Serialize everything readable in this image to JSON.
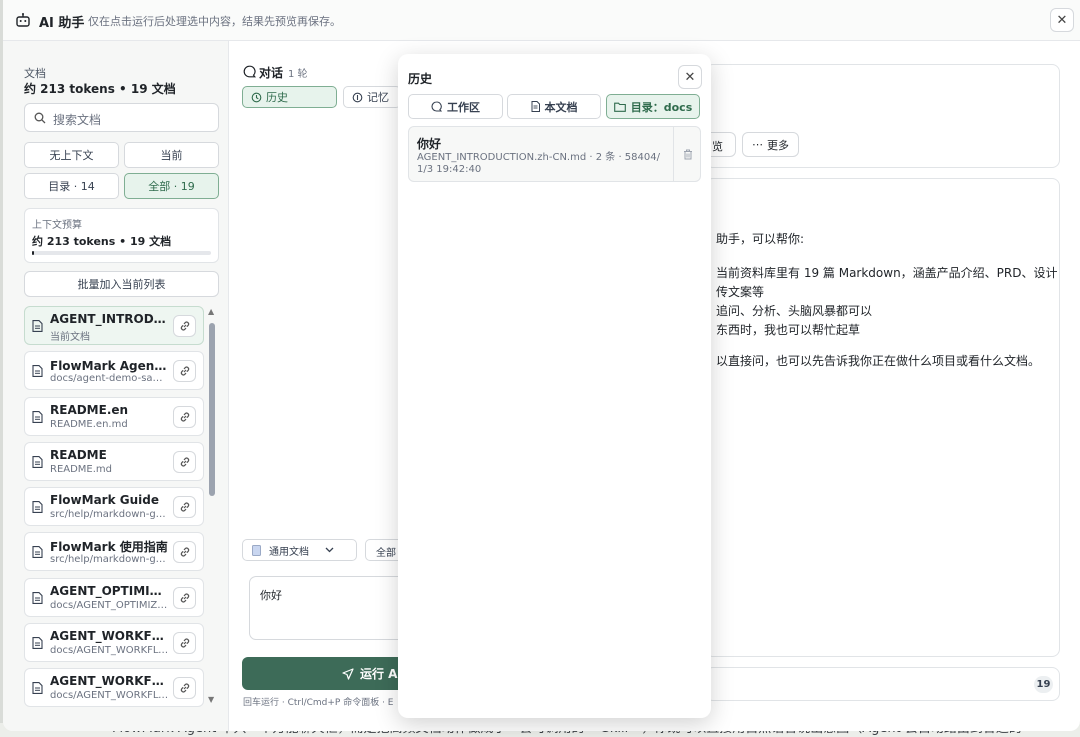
{
  "header": {
    "title": "AI 助手",
    "subtitle": "仅在点击运行后处理选中内容，结果先预览再保存。"
  },
  "sidebar": {
    "label": "文档",
    "tokens": "约 213 tokens • 19 文档",
    "search_placeholder": "搜索文档",
    "filters": [
      "无上下文",
      "当前",
      "目录 · 14",
      "全部 · 19"
    ],
    "active_filter": "全部 · 19",
    "budget_label": "上下文预算",
    "budget_value": "约 213 tokens • 19 文档",
    "budget_fraction": 0.01,
    "batch_label": "批量加入当前列表",
    "docs": [
      {
        "name": "AGENT_INTRODUCTION.zh-CN",
        "path": "当前文档"
      },
      {
        "name": "FlowMark Agent 演示",
        "path": "docs/agent-demo-samples"
      },
      {
        "name": "README.en",
        "path": "README.en.md"
      },
      {
        "name": "README",
        "path": "README.md"
      },
      {
        "name": "FlowMark Guide",
        "path": "src/help/markdown-guide"
      },
      {
        "name": "FlowMark 使用指南",
        "path": "src/help/markdown-guide"
      },
      {
        "name": "AGENT_OPTIMIZATION",
        "path": "docs/AGENT_OPTIMIZATION"
      },
      {
        "name": "AGENT_WORKFLOW",
        "path": "docs/AGENT_WORKFLOW"
      },
      {
        "name": "AGENT_WORKFLOW",
        "path": "docs/AGENT_WORKFLOW"
      }
    ]
  },
  "conversation": {
    "title": "对话",
    "rounds": "1 轮",
    "tabs": [
      "历史",
      "记忆"
    ],
    "template_select": "通用文档",
    "scope": "全部",
    "input_value": "你好",
    "run_label": "运行 AI",
    "hint": "回车运行 · Ctrl/Cmd+P 命令面板 · E"
  },
  "history": {
    "title": "历史",
    "filters": [
      "工作区",
      "本文档",
      "目录：docs"
    ],
    "active_filter": "目录：docs",
    "items": [
      {
        "title": "你好",
        "meta": "AGENT_INTRODUCTION.zh-CN.md · 2 条 · 58404/1/3 19:42:40"
      }
    ]
  },
  "preview": {
    "buttons": [
      "览",
      "更多"
    ],
    "lines": [
      "助手，可以帮你:",
      "当前资料库里有 19 篇 Markdown，涵盖产品介绍、PRD、设计",
      "传文案等",
      "追问、分析、头脑风暴都可以",
      "东西时，我也可以帮忙起草",
      "以直接问，也可以先告诉我你正在做什么项目或看什么文档。"
    ],
    "count_badge": "19"
  },
  "background_text": "FlowMark Agent 不只一个万能聊天框，而是把高频文档动作做成了一套可调用的 **Skill**，你既可以直接用自然语言说出意图（Agent 会自动路由到合适的"
}
